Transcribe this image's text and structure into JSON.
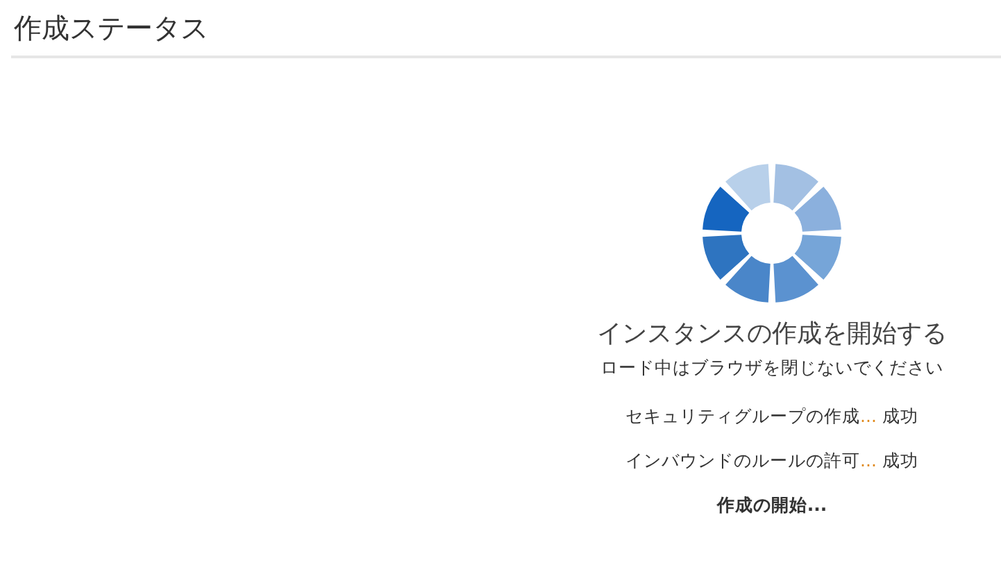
{
  "header": {
    "title": "作成ステータス"
  },
  "status": {
    "heading": "インスタンスの作成を開始する",
    "note": "ロード中はブラウザを閉じないでください"
  },
  "steps": [
    {
      "kind": "done",
      "label": "セキュリティグループの作成",
      "dots": "...",
      "result": "成功"
    },
    {
      "kind": "done",
      "label": "インバウンドのルールの許可",
      "dots": "...",
      "result": "成功"
    },
    {
      "kind": "pending",
      "label": "作成の開始",
      "dots": "..."
    }
  ]
}
